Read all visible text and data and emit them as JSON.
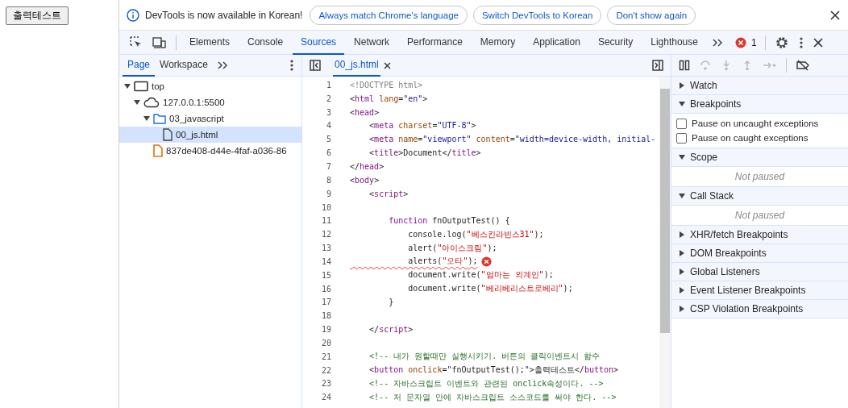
{
  "page_button": "출력테스트",
  "infobar": {
    "message": "DevTools is now available in Korean!",
    "buttons": [
      "Always match Chrome's language",
      "Switch DevTools to Korean",
      "Don't show again"
    ]
  },
  "main_tabs": [
    {
      "label": "Elements",
      "selected": false
    },
    {
      "label": "Console",
      "selected": false
    },
    {
      "label": "Sources",
      "selected": true
    },
    {
      "label": "Network",
      "selected": false
    },
    {
      "label": "Performance",
      "selected": false
    },
    {
      "label": "Memory",
      "selected": false
    },
    {
      "label": "Application",
      "selected": false
    },
    {
      "label": "Security",
      "selected": false
    },
    {
      "label": "Lighthouse",
      "selected": false
    }
  ],
  "error_count": "1",
  "navigator": {
    "tabs": [
      {
        "label": "Page",
        "selected": true
      },
      {
        "label": "Workspace",
        "selected": false
      }
    ],
    "tree": [
      {
        "label": "top",
        "kind": "frame",
        "expanded": true,
        "selected": false,
        "children": [
          {
            "label": "127.0.0.1:5500",
            "kind": "cloud",
            "expanded": true,
            "selected": false,
            "children": [
              {
                "label": "03_javascript",
                "kind": "folder",
                "expanded": true,
                "selected": false,
                "children": [
                  {
                    "label": "00_js.html",
                    "kind": "file",
                    "selected": true
                  }
                ]
              },
              {
                "label": "837de408-d44e-4faf-a036-86",
                "kind": "script",
                "selected": false
              }
            ]
          }
        ]
      }
    ]
  },
  "editor": {
    "tab": "00_js.html",
    "lines": [
      {
        "n": "1",
        "tokens": [
          {
            "kind": "doctype",
            "t": "<!DOCTYPE html>"
          }
        ]
      },
      {
        "n": "2",
        "tokens": [
          {
            "kind": "plain",
            "t": "<"
          },
          {
            "kind": "tag",
            "t": "html"
          },
          {
            "kind": "attr",
            "t": " lang"
          },
          {
            "kind": "plain",
            "t": "="
          },
          {
            "kind": "value",
            "t": "\"en\""
          },
          {
            "kind": "plain",
            "t": ">"
          }
        ]
      },
      {
        "n": "3",
        "tokens": [
          {
            "kind": "plain",
            "t": "<"
          },
          {
            "kind": "tag",
            "t": "head"
          },
          {
            "kind": "plain",
            "t": ">"
          }
        ]
      },
      {
        "n": "4",
        "tokens": [
          {
            "kind": "plain",
            "t": "    <"
          },
          {
            "kind": "tag",
            "t": "meta"
          },
          {
            "kind": "attr",
            "t": " charset"
          },
          {
            "kind": "plain",
            "t": "="
          },
          {
            "kind": "value",
            "t": "\"UTF-8\""
          },
          {
            "kind": "plain",
            "t": ">"
          }
        ]
      },
      {
        "n": "5",
        "tokens": [
          {
            "kind": "plain",
            "t": "    <"
          },
          {
            "kind": "tag",
            "t": "meta"
          },
          {
            "kind": "attr",
            "t": " name"
          },
          {
            "kind": "plain",
            "t": "="
          },
          {
            "kind": "value",
            "t": "\"viewport\""
          },
          {
            "kind": "attr",
            "t": " content"
          },
          {
            "kind": "plain",
            "t": "="
          },
          {
            "kind": "value",
            "t": "\"width=device-width, initial-"
          }
        ]
      },
      {
        "n": "6",
        "tokens": [
          {
            "kind": "plain",
            "t": "    <"
          },
          {
            "kind": "tag",
            "t": "title"
          },
          {
            "kind": "plain",
            "t": ">Document</"
          },
          {
            "kind": "tag",
            "t": "title"
          },
          {
            "kind": "plain",
            "t": ">"
          }
        ]
      },
      {
        "n": "7",
        "tokens": [
          {
            "kind": "plain",
            "t": "</"
          },
          {
            "kind": "tag",
            "t": "head"
          },
          {
            "kind": "plain",
            "t": ">"
          }
        ]
      },
      {
        "n": "8",
        "tokens": [
          {
            "kind": "plain",
            "t": "<"
          },
          {
            "kind": "tag",
            "t": "body"
          },
          {
            "kind": "plain",
            "t": ">"
          }
        ]
      },
      {
        "n": "9",
        "tokens": [
          {
            "kind": "plain",
            "t": "    <"
          },
          {
            "kind": "tag",
            "t": "script"
          },
          {
            "kind": "plain",
            "t": ">"
          }
        ]
      },
      {
        "n": "10"
      },
      {
        "n": "11",
        "tokens": [
          {
            "kind": "keyword",
            "t": "        function"
          },
          {
            "kind": "plain",
            "t": " fnOutputTest() {"
          }
        ]
      },
      {
        "n": "12",
        "tokens": [
          {
            "kind": "plain",
            "t": "            console.log("
          },
          {
            "kind": "string",
            "t": "\"베스킨라빈스31\""
          },
          {
            "kind": "plain",
            "t": ");"
          }
        ]
      },
      {
        "n": "13",
        "tokens": [
          {
            "kind": "plain",
            "t": "            alert("
          },
          {
            "kind": "string",
            "t": "\"아이스크림\""
          },
          {
            "kind": "plain",
            "t": ");"
          }
        ]
      },
      {
        "n": "14",
        "error": true,
        "tokens": [
          {
            "kind": "plain",
            "t": "            alerts("
          },
          {
            "kind": "string",
            "t": "\"오타\""
          },
          {
            "kind": "plain",
            "t": ");"
          }
        ]
      },
      {
        "n": "15",
        "tokens": [
          {
            "kind": "plain",
            "t": "            document.write("
          },
          {
            "kind": "string",
            "t": "\"엄마는 외계인\""
          },
          {
            "kind": "plain",
            "t": ");"
          }
        ]
      },
      {
        "n": "16",
        "tokens": [
          {
            "kind": "plain",
            "t": "            document.write("
          },
          {
            "kind": "string",
            "t": "\"베리베리스트로베리\""
          },
          {
            "kind": "plain",
            "t": ");"
          }
        ]
      },
      {
        "n": "17",
        "tokens": [
          {
            "kind": "plain",
            "t": "        }"
          }
        ]
      },
      {
        "n": "18"
      },
      {
        "n": "19",
        "tokens": [
          {
            "kind": "plain",
            "t": "    </"
          },
          {
            "kind": "tag",
            "t": "script"
          },
          {
            "kind": "plain",
            "t": ">"
          }
        ]
      },
      {
        "n": "20"
      },
      {
        "n": "21",
        "tokens": [
          {
            "kind": "comment",
            "t": "    <!-- 내가 원할때만 실행시키기. 버튼의 클릭이벤트시 함수"
          }
        ]
      },
      {
        "n": "22",
        "tokens": [
          {
            "kind": "plain",
            "t": "    <"
          },
          {
            "kind": "tag",
            "t": "button"
          },
          {
            "kind": "attr",
            "t": " onclick"
          },
          {
            "kind": "plain",
            "t": "="
          },
          {
            "kind": "value",
            "t": "\""
          },
          {
            "kind": "plain",
            "t": "fnOutputTest();"
          },
          {
            "kind": "value",
            "t": "\""
          },
          {
            "kind": "plain",
            "t": ">출력테스트</"
          },
          {
            "kind": "tag",
            "t": "button"
          },
          {
            "kind": "plain",
            "t": ">"
          }
        ]
      },
      {
        "n": "23",
        "tokens": [
          {
            "kind": "comment",
            "t": "    <!-- 자바스크립트 이벤트와 관련된 onclick속성이다. -->"
          }
        ]
      },
      {
        "n": "24",
        "tokens": [
          {
            "kind": "comment",
            "t": "    <!-- 저 문자열 안에 자바스크립트 소스코드를 써야 한다. -->"
          }
        ]
      }
    ]
  },
  "debugger": {
    "sections": [
      {
        "title": "Watch",
        "expanded": false
      },
      {
        "title": "Breakpoints",
        "expanded": true,
        "checkboxes": [
          {
            "label": "Pause on uncaught exceptions",
            "checked": false
          },
          {
            "label": "Pause on caught exceptions",
            "checked": false
          }
        ]
      },
      {
        "title": "Scope",
        "expanded": true,
        "message": "Not paused"
      },
      {
        "title": "Call Stack",
        "expanded": true,
        "message": "Not paused"
      },
      {
        "title": "XHR/fetch Breakpoints",
        "expanded": false
      },
      {
        "title": "DOM Breakpoints",
        "expanded": false
      },
      {
        "title": "Global Listeners",
        "expanded": false
      },
      {
        "title": "Event Listener Breakpoints",
        "expanded": false
      },
      {
        "title": "CSP Violation Breakpoints",
        "expanded": false
      }
    ]
  }
}
